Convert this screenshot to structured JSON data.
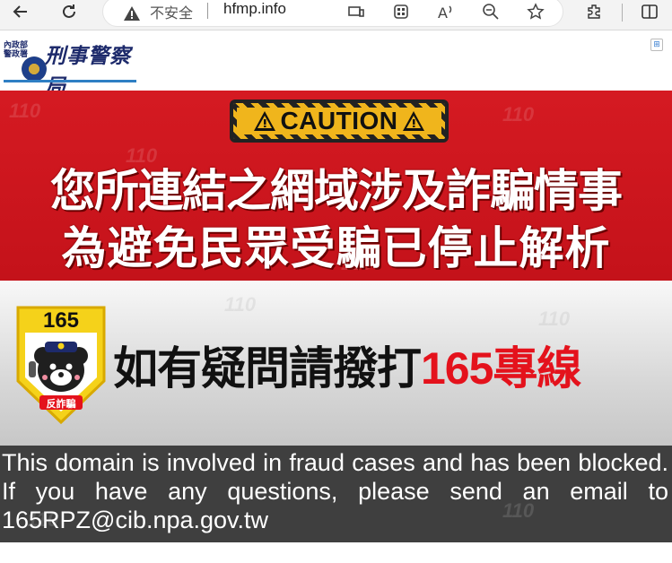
{
  "browser": {
    "address": {
      "security_label": "不安全",
      "url": "hfmp.info"
    },
    "icons": [
      "back-icon",
      "refresh-icon",
      "warning-icon",
      "reader-mode-icon",
      "apps-icon",
      "read-aloud-icon",
      "zoom-out-icon",
      "favorite-star-icon",
      "extensions-icon",
      "split-screen-icon"
    ]
  },
  "header": {
    "agency_small": "內政部\n警政署",
    "agency_name": "刑事警察局"
  },
  "banner": {
    "caution_label": "CAUTION",
    "line1": "您所連結之網域涉及詐騙情事",
    "line2": "為避免民眾受騙已停止解析"
  },
  "hotline": {
    "badge_number": "165",
    "badge_caption": "反詐騙",
    "text": "如有疑問請撥打",
    "number_text": "165專線"
  },
  "notice": {
    "english": "This domain is involved in fraud cases and has been blocked. If you have any questions, please send an email to 165RPZ@cib.npa.gov.tw"
  },
  "watermark_text": "110",
  "colors": {
    "banner_red": "#c4121a",
    "caution_yellow": "#f0b51c",
    "hotline_red": "#e4121c",
    "notice_bg": "#3f3f3f",
    "agency_blue": "#1d2a6b"
  }
}
